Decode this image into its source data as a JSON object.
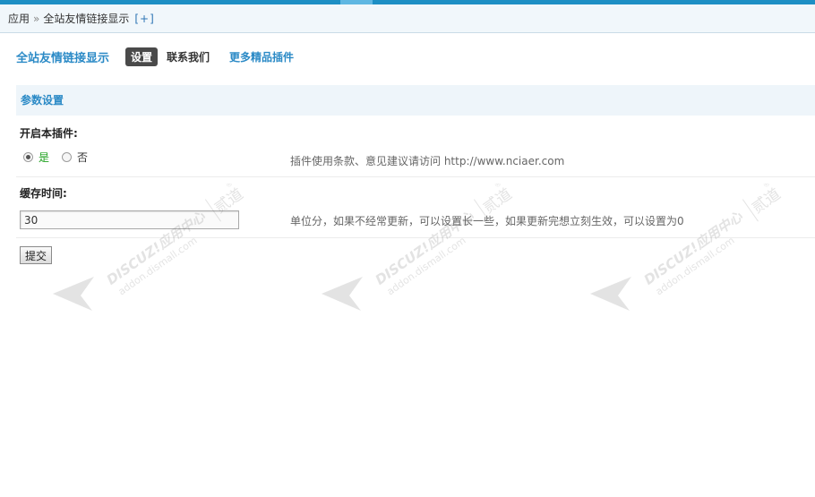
{
  "breadcrumb": {
    "root": "应用",
    "separator": "»",
    "current": "全站友情链接显示",
    "add": "[+]"
  },
  "header": {
    "title": "全站友情链接显示",
    "tabs": [
      {
        "label": "设置",
        "active": true
      },
      {
        "label": "联系我们",
        "active": false
      },
      {
        "label": "更多精品插件",
        "active": false
      }
    ]
  },
  "section": {
    "title": "参数设置"
  },
  "settings": {
    "enable": {
      "label": "开启本插件:",
      "options": [
        "是",
        "否"
      ],
      "selected": "是",
      "hint": "插件使用条款、意见建议请访问 http://www.nciaer.com"
    },
    "cache": {
      "label": "缓存时间:",
      "value": "30",
      "hint": "单位分，如果不经常更新，可以设置长一些，如果更新完想立刻生效，可以设置为0"
    }
  },
  "submit_label": "提交",
  "watermark": {
    "brand": "DISCUZ!应用中心",
    "domain": "addon.dismall.com",
    "mark": "贰道",
    "registered": "®"
  },
  "colors": {
    "accent": "#2b8ac6",
    "top_strip": "#1d8fc4",
    "yes_option": "#1ea11e",
    "section_bg": "#eef5fa"
  }
}
